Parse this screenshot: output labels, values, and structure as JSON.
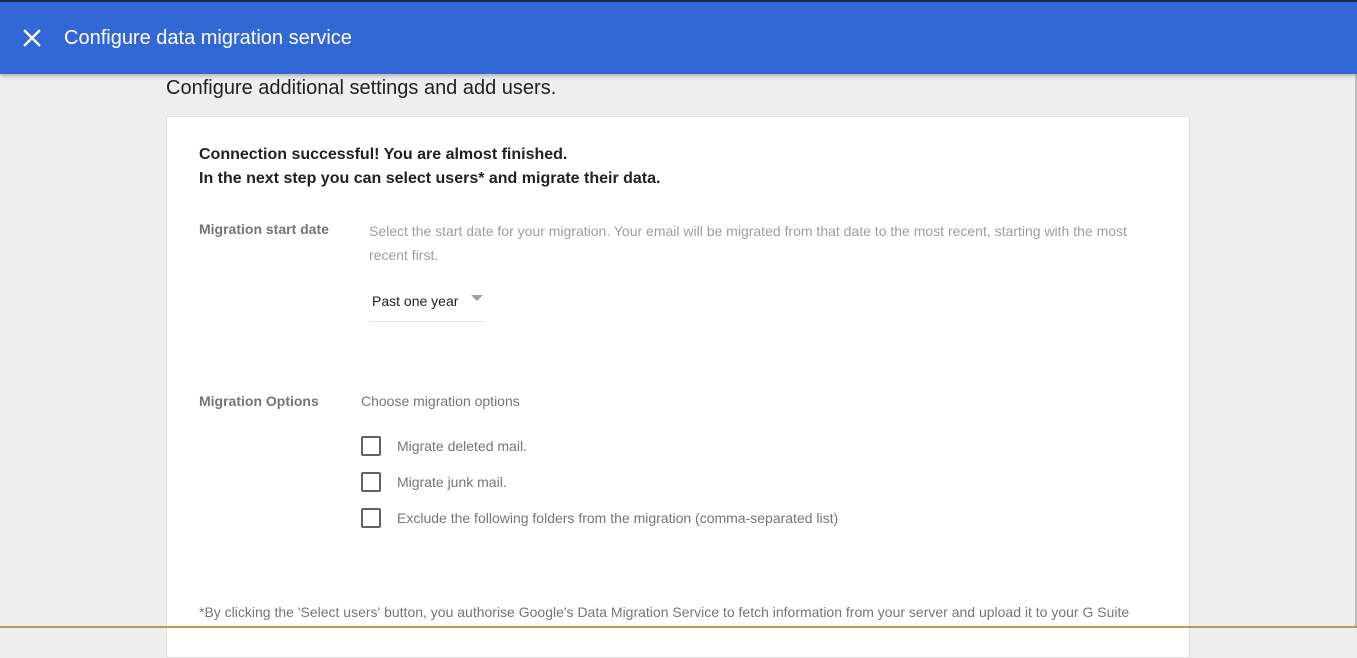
{
  "header": {
    "title": "Configure data migration service",
    "close_icon": "close-icon"
  },
  "page": {
    "subtitle": "Configure additional settings and add users."
  },
  "card": {
    "success_line1": "Connection successful! You are almost finished.",
    "success_line2": "In the next step you can select users* and migrate their data.",
    "start_date": {
      "label": "Migration start date",
      "description": "Select the start date for your migration. Your email will be migrated from that date to the most recent, starting with the most recent first.",
      "selected": "Past one year"
    },
    "options": {
      "label": "Migration Options",
      "heading": "Choose migration options",
      "items": [
        {
          "label": "Migrate deleted mail.",
          "checked": false
        },
        {
          "label": "Migrate junk mail.",
          "checked": false
        },
        {
          "label": "Exclude the following folders from the migration (comma-separated list)",
          "checked": false
        }
      ]
    },
    "disclaimer": "*By clicking the 'Select users' button, you authorise Google's Data Migration Service to fetch information from your server and upload it to your G Suite"
  },
  "colors": {
    "header_bg": "#3367d6",
    "page_bg": "#eeeeee",
    "card_bg": "#ffffff"
  }
}
